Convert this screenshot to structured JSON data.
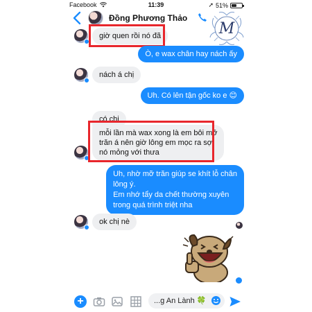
{
  "status_bar": {
    "carrier": "Facebook",
    "time": "11:39",
    "battery": "51%",
    "battery_level": 0.51
  },
  "header": {
    "contact_name": "Đồng Phương Thảo"
  },
  "watermark": {
    "monogram": "M"
  },
  "messages": [
    {
      "side": "in",
      "text": "giờ quen rồi nó đã"
    },
    {
      "side": "out",
      "text": "Ò, e wax chân hay nách ấy"
    },
    {
      "side": "in",
      "text": "nách á chị"
    },
    {
      "side": "out",
      "text": "Uh. Có lên tận gốc ko e 😊"
    },
    {
      "side": "in",
      "text": "có chị"
    },
    {
      "side": "in",
      "lines": [
        "mỗi lần mà wax xong là em bôi mỡ",
        "trăn á nên giờ lông em mọc ra sợi",
        "nó mỏng với thưa"
      ]
    },
    {
      "side": "out",
      "lines": [
        "Uh, nhờ mỡ trăn giúp se khít lỗ chân",
        "lông ý.",
        "Em nhớ tẩy da chết thường xuyên",
        "trong quá trình triệt nha"
      ]
    },
    {
      "side": "in",
      "text": "ok chị nè"
    }
  ],
  "composer": {
    "input_value": "...g An Lành 🍀"
  },
  "colors": {
    "outgoing_bubble": "#1a8cff",
    "incoming_bubble": "#eeeff1",
    "highlight_box": "#e8262c"
  },
  "icons": [
    "back-arrow-icon",
    "phone-icon",
    "video-icon",
    "plus-icon",
    "camera-icon",
    "image-icon",
    "grid-icon",
    "smile-icon",
    "send-icon",
    "sticker-dog"
  ]
}
